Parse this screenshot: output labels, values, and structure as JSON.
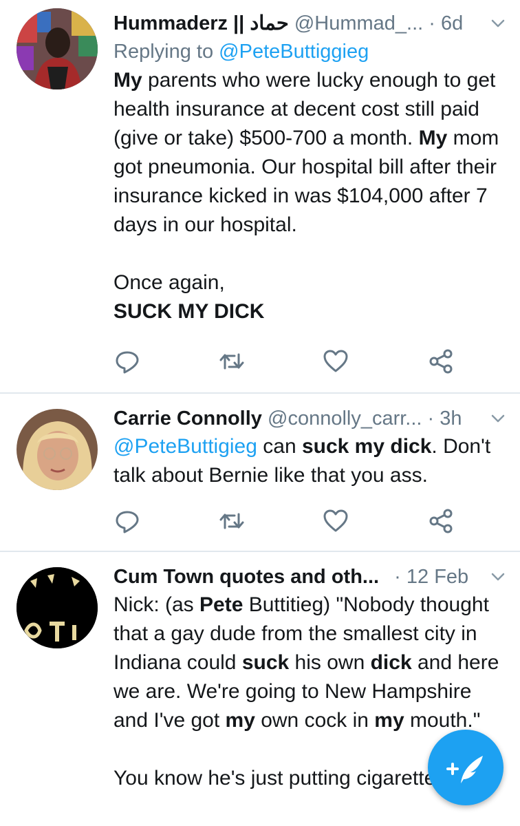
{
  "tweets": [
    {
      "name": "Hummaderz || حماد",
      "handle": "@Hummad_...",
      "time": "6d",
      "replying_prefix": "Replying to",
      "replying_to": "@PeteButtiggieg",
      "body_segments": [
        {
          "text": "My",
          "bold": true
        },
        {
          "text": " parents who were lucky enough to get health insurance at decent cost still paid (give or take) $500-700 a month. "
        },
        {
          "text": "My",
          "bold": true
        },
        {
          "text": " mom got pneumonia. Our hospital bill after their insurance kicked in was $104,000 after 7 days in our hospital."
        }
      ],
      "body_line2": "Once again,",
      "body_line3": "SUCK MY DICK"
    },
    {
      "name": "Carrie Connolly",
      "handle": "@connolly_carr...",
      "time": "3h",
      "body_segments": [
        {
          "text": "@PeteButtigieg",
          "mention": true
        },
        {
          "text": " can "
        },
        {
          "text": "suck my dick",
          "bold": true
        },
        {
          "text": ". Don't talk about Bernie like that you ass."
        }
      ]
    },
    {
      "name": "Cum Town quotes and oth...",
      "time": "12 Feb",
      "body_segments": [
        {
          "text": "Nick: (as "
        },
        {
          "text": "Pete",
          "bold": true
        },
        {
          "text": " Buttitieg) \"Nobody thought that a gay dude from the smallest city in Indiana could "
        },
        {
          "text": "suck",
          "bold": true
        },
        {
          "text": " his own "
        },
        {
          "text": "dick",
          "bold": true
        },
        {
          "text": " and here we are. We're going to New Hampshire and I've got "
        },
        {
          "text": "my",
          "bold": true
        },
        {
          "text": " own cock in "
        },
        {
          "text": "my",
          "bold": true
        },
        {
          "text": " mouth.\""
        }
      ],
      "body_line2": "You know he's just putting cigarettes out"
    }
  ],
  "colors": {
    "accent": "#1da1f2",
    "secondary_text": "#657786",
    "divider": "#e1e8ed"
  },
  "icons": [
    "reply-icon",
    "retweet-icon",
    "like-icon",
    "share-icon",
    "chevron-down-icon",
    "compose-tweet-icon"
  ]
}
